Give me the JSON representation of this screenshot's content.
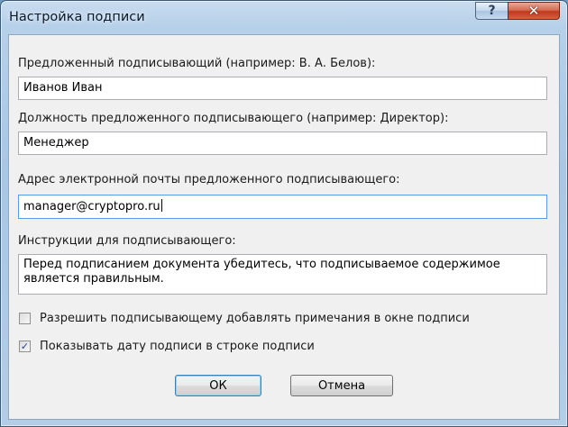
{
  "window": {
    "title": "Настройка подписи",
    "help_glyph": "?",
    "close_glyph": "✕"
  },
  "fields": {
    "signer": {
      "label": "Предложенный подписывающий (например: В. А. Белов):",
      "value": "Иванов Иван"
    },
    "title": {
      "label": "Должность предложенного подписывающего (например: Директор):",
      "value": "Менеджер"
    },
    "email": {
      "label": "Адрес электронной почты предложенного подписывающего:",
      "value": "manager@cryptopro.ru"
    },
    "instructions": {
      "label": "Инструкции для подписывающего:",
      "value": "Перед подписанием документа убедитесь, что подписываемое содержимое является правильным."
    }
  },
  "options": {
    "allow_comments": {
      "label": "Разрешить подписывающему добавлять примечания в окне подписи",
      "checked": false
    },
    "show_date": {
      "label": "Показывать дату подписи в строке подписи",
      "checked": true
    }
  },
  "buttons": {
    "ok": "ОК",
    "cancel": "Отмена"
  }
}
